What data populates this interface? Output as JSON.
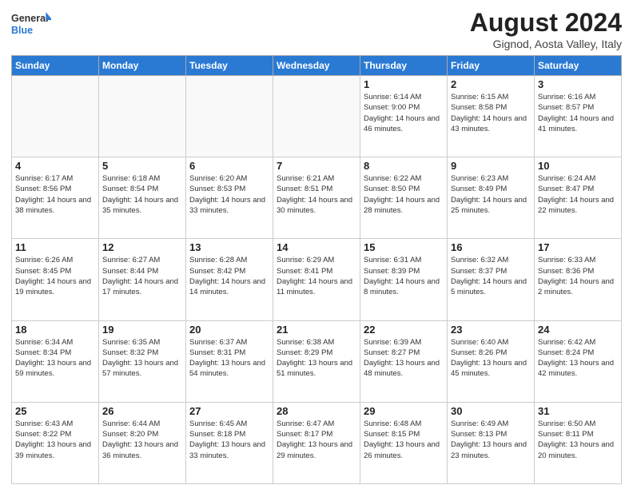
{
  "logo": {
    "general": "General",
    "blue": "Blue"
  },
  "title": "August 2024",
  "subtitle": "Gignod, Aosta Valley, Italy",
  "weekdays": [
    "Sunday",
    "Monday",
    "Tuesday",
    "Wednesday",
    "Thursday",
    "Friday",
    "Saturday"
  ],
  "weeks": [
    [
      {
        "day": "",
        "info": ""
      },
      {
        "day": "",
        "info": ""
      },
      {
        "day": "",
        "info": ""
      },
      {
        "day": "",
        "info": ""
      },
      {
        "day": "1",
        "info": "Sunrise: 6:14 AM\nSunset: 9:00 PM\nDaylight: 14 hours and 46 minutes."
      },
      {
        "day": "2",
        "info": "Sunrise: 6:15 AM\nSunset: 8:58 PM\nDaylight: 14 hours and 43 minutes."
      },
      {
        "day": "3",
        "info": "Sunrise: 6:16 AM\nSunset: 8:57 PM\nDaylight: 14 hours and 41 minutes."
      }
    ],
    [
      {
        "day": "4",
        "info": "Sunrise: 6:17 AM\nSunset: 8:56 PM\nDaylight: 14 hours and 38 minutes."
      },
      {
        "day": "5",
        "info": "Sunrise: 6:18 AM\nSunset: 8:54 PM\nDaylight: 14 hours and 35 minutes."
      },
      {
        "day": "6",
        "info": "Sunrise: 6:20 AM\nSunset: 8:53 PM\nDaylight: 14 hours and 33 minutes."
      },
      {
        "day": "7",
        "info": "Sunrise: 6:21 AM\nSunset: 8:51 PM\nDaylight: 14 hours and 30 minutes."
      },
      {
        "day": "8",
        "info": "Sunrise: 6:22 AM\nSunset: 8:50 PM\nDaylight: 14 hours and 28 minutes."
      },
      {
        "day": "9",
        "info": "Sunrise: 6:23 AM\nSunset: 8:49 PM\nDaylight: 14 hours and 25 minutes."
      },
      {
        "day": "10",
        "info": "Sunrise: 6:24 AM\nSunset: 8:47 PM\nDaylight: 14 hours and 22 minutes."
      }
    ],
    [
      {
        "day": "11",
        "info": "Sunrise: 6:26 AM\nSunset: 8:45 PM\nDaylight: 14 hours and 19 minutes."
      },
      {
        "day": "12",
        "info": "Sunrise: 6:27 AM\nSunset: 8:44 PM\nDaylight: 14 hours and 17 minutes."
      },
      {
        "day": "13",
        "info": "Sunrise: 6:28 AM\nSunset: 8:42 PM\nDaylight: 14 hours and 14 minutes."
      },
      {
        "day": "14",
        "info": "Sunrise: 6:29 AM\nSunset: 8:41 PM\nDaylight: 14 hours and 11 minutes."
      },
      {
        "day": "15",
        "info": "Sunrise: 6:31 AM\nSunset: 8:39 PM\nDaylight: 14 hours and 8 minutes."
      },
      {
        "day": "16",
        "info": "Sunrise: 6:32 AM\nSunset: 8:37 PM\nDaylight: 14 hours and 5 minutes."
      },
      {
        "day": "17",
        "info": "Sunrise: 6:33 AM\nSunset: 8:36 PM\nDaylight: 14 hours and 2 minutes."
      }
    ],
    [
      {
        "day": "18",
        "info": "Sunrise: 6:34 AM\nSunset: 8:34 PM\nDaylight: 13 hours and 59 minutes."
      },
      {
        "day": "19",
        "info": "Sunrise: 6:35 AM\nSunset: 8:32 PM\nDaylight: 13 hours and 57 minutes."
      },
      {
        "day": "20",
        "info": "Sunrise: 6:37 AM\nSunset: 8:31 PM\nDaylight: 13 hours and 54 minutes."
      },
      {
        "day": "21",
        "info": "Sunrise: 6:38 AM\nSunset: 8:29 PM\nDaylight: 13 hours and 51 minutes."
      },
      {
        "day": "22",
        "info": "Sunrise: 6:39 AM\nSunset: 8:27 PM\nDaylight: 13 hours and 48 minutes."
      },
      {
        "day": "23",
        "info": "Sunrise: 6:40 AM\nSunset: 8:26 PM\nDaylight: 13 hours and 45 minutes."
      },
      {
        "day": "24",
        "info": "Sunrise: 6:42 AM\nSunset: 8:24 PM\nDaylight: 13 hours and 42 minutes."
      }
    ],
    [
      {
        "day": "25",
        "info": "Sunrise: 6:43 AM\nSunset: 8:22 PM\nDaylight: 13 hours and 39 minutes."
      },
      {
        "day": "26",
        "info": "Sunrise: 6:44 AM\nSunset: 8:20 PM\nDaylight: 13 hours and 36 minutes."
      },
      {
        "day": "27",
        "info": "Sunrise: 6:45 AM\nSunset: 8:18 PM\nDaylight: 13 hours and 33 minutes."
      },
      {
        "day": "28",
        "info": "Sunrise: 6:47 AM\nSunset: 8:17 PM\nDaylight: 13 hours and 29 minutes."
      },
      {
        "day": "29",
        "info": "Sunrise: 6:48 AM\nSunset: 8:15 PM\nDaylight: 13 hours and 26 minutes."
      },
      {
        "day": "30",
        "info": "Sunrise: 6:49 AM\nSunset: 8:13 PM\nDaylight: 13 hours and 23 minutes."
      },
      {
        "day": "31",
        "info": "Sunrise: 6:50 AM\nSunset: 8:11 PM\nDaylight: 13 hours and 20 minutes."
      }
    ]
  ]
}
